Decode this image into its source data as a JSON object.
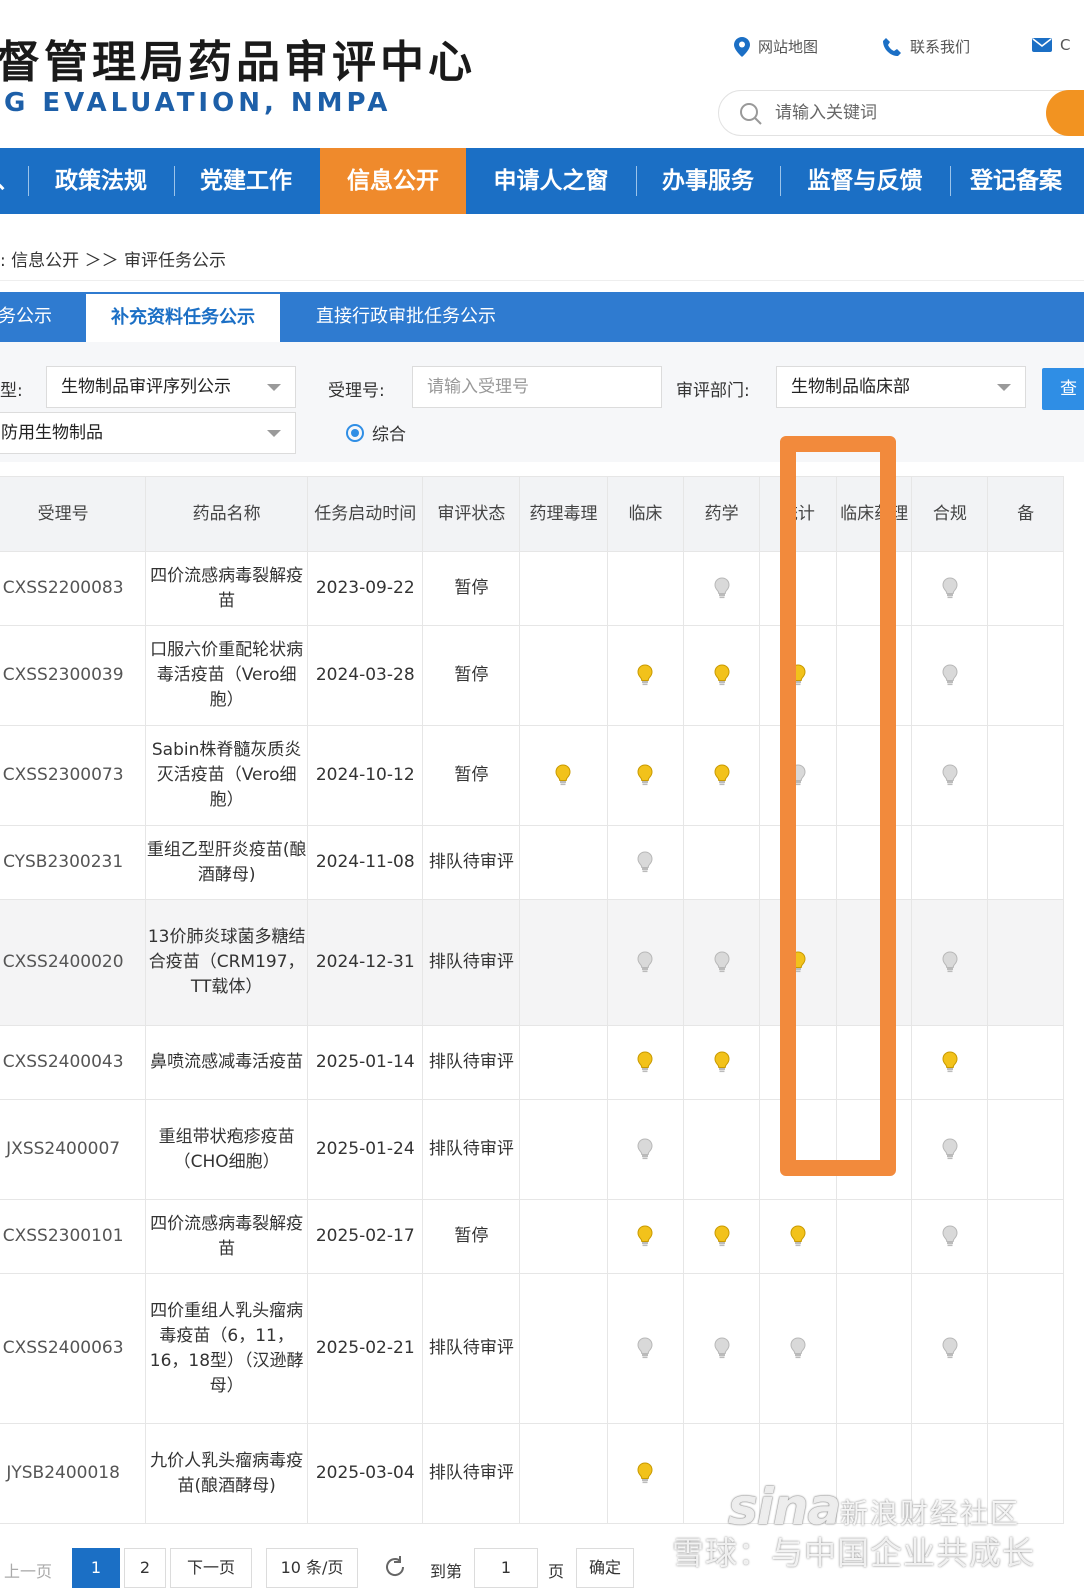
{
  "header": {
    "title_cn": "督管理局药品审评中心",
    "title_en": "G EVALUATION, NMPA",
    "links": [
      {
        "label": "网站地图",
        "icon": "map-pin-icon"
      },
      {
        "label": "联系我们",
        "icon": "phone-icon"
      },
      {
        "label": "C",
        "icon": "mail-icon"
      }
    ],
    "search_placeholder": "请输入关键词",
    "accent": "#f29321"
  },
  "nav": {
    "lead_fragment": "、",
    "items": [
      {
        "label": "政策法规",
        "active": false
      },
      {
        "label": "党建工作",
        "active": false
      },
      {
        "label": "信息公开",
        "active": true
      },
      {
        "label": "申请人之窗",
        "active": false
      },
      {
        "label": "办事服务",
        "active": false
      },
      {
        "label": "监督与反馈",
        "active": false
      },
      {
        "label": "登记备案",
        "active": false
      }
    ],
    "color": "#1b6fc5",
    "active_color": "#ef8a2c"
  },
  "breadcrumb": ": 信息公开 ＞＞ 审评任务公示",
  "tabs": [
    {
      "label": "务公示",
      "active": false
    },
    {
      "label": "补充资料任务公示",
      "active": true
    },
    {
      "label": "直接行政审批任务公示",
      "active": false
    }
  ],
  "filters": {
    "type_label": "型:",
    "type_value": "生物制品审评序列公示",
    "accept_no_label": "受理号:",
    "accept_no_placeholder": "请输入受理号",
    "dept_label": "审评部门:",
    "dept_value": "生物制品临床部",
    "query_label": "查",
    "category_value": "防用生物制品",
    "radio_label": "综合"
  },
  "table": {
    "headers": [
      "受理号",
      "药品名称",
      "任务启动时间",
      "审评状态",
      "药理毒理",
      "临床",
      "药学",
      "统计",
      "临床药理",
      "合规",
      "备"
    ],
    "rows": [
      {
        "code": "CXSS2200083",
        "name": "四价流感病毒裂解疫苗",
        "date": "2023-09-22",
        "status": "暂停",
        "marks": [
          "",
          "",
          "off",
          "",
          "",
          "off",
          ""
        ]
      },
      {
        "code": "CXSS2300039",
        "name": "口服六价重配轮状病毒活疫苗（Vero细胞）",
        "date": "2024-03-28",
        "status": "暂停",
        "marks": [
          "",
          "on",
          "on",
          "on",
          "",
          "off",
          ""
        ]
      },
      {
        "code": "CXSS2300073",
        "name": "Sabin株脊髓灰质炎灭活疫苗（Vero细胞）",
        "date": "2024-10-12",
        "status": "暂停",
        "marks": [
          "on",
          "on",
          "on",
          "off",
          "",
          "off",
          ""
        ]
      },
      {
        "code": "CYSB2300231",
        "name": "重组乙型肝炎疫苗(酿酒酵母)",
        "date": "2024-11-08",
        "status": "排队待审评",
        "marks": [
          "",
          "off",
          "",
          "",
          "",
          "",
          ""
        ]
      },
      {
        "code": "CXSS2400020",
        "name": "13价肺炎球菌多糖结合疫苗（CRM197，TT载体）",
        "date": "2024-12-31",
        "status": "排队待审评",
        "marks": [
          "",
          "off",
          "off",
          "on",
          "",
          "off",
          ""
        ]
      },
      {
        "code": "CXSS2400043",
        "name": "鼻喷流感减毒活疫苗",
        "date": "2025-01-14",
        "status": "排队待审评",
        "marks": [
          "",
          "on",
          "on",
          "",
          "",
          "on",
          ""
        ]
      },
      {
        "code": "JXSS2400007",
        "name": "重组带状疱疹疫苗（CHO细胞）",
        "date": "2025-01-24",
        "status": "排队待审评",
        "marks": [
          "",
          "off",
          "",
          "",
          "",
          "off",
          ""
        ]
      },
      {
        "code": "CXSS2300101",
        "name": "四价流感病毒裂解疫苗",
        "date": "2025-02-17",
        "status": "暂停",
        "marks": [
          "",
          "on",
          "on",
          "on",
          "",
          "off",
          ""
        ]
      },
      {
        "code": "CXSS2400063",
        "name": "四价重组人乳头瘤病毒疫苗（6，11，16，18型）（汉逊酵母）",
        "date": "2025-02-21",
        "status": "排队待审评",
        "marks": [
          "",
          "off",
          "off",
          "off",
          "",
          "off",
          ""
        ]
      },
      {
        "code": "JYSB2400018",
        "name": "九价人乳头瘤病毒疫苗(酿酒酵母)",
        "date": "2025-03-04",
        "status": "排队待审评",
        "marks": [
          "",
          "on",
          "",
          "",
          "",
          "",
          ""
        ]
      }
    ],
    "bulb_on_color": "#f2c21b",
    "bulb_off_color": "#d9d9d9",
    "highlight_color": "#f28a3c"
  },
  "pager": {
    "prev": "上一页",
    "pages": [
      "1",
      "2"
    ],
    "next": "下一页",
    "page_size": "10 条/页",
    "goto_label": "到第",
    "goto_value": "1",
    "page_unit": "页",
    "confirm": "确定"
  },
  "watermark": {
    "logo": "sina",
    "site": "新浪财经社区",
    "snowball": "雪球：与中国企业共成长"
  }
}
